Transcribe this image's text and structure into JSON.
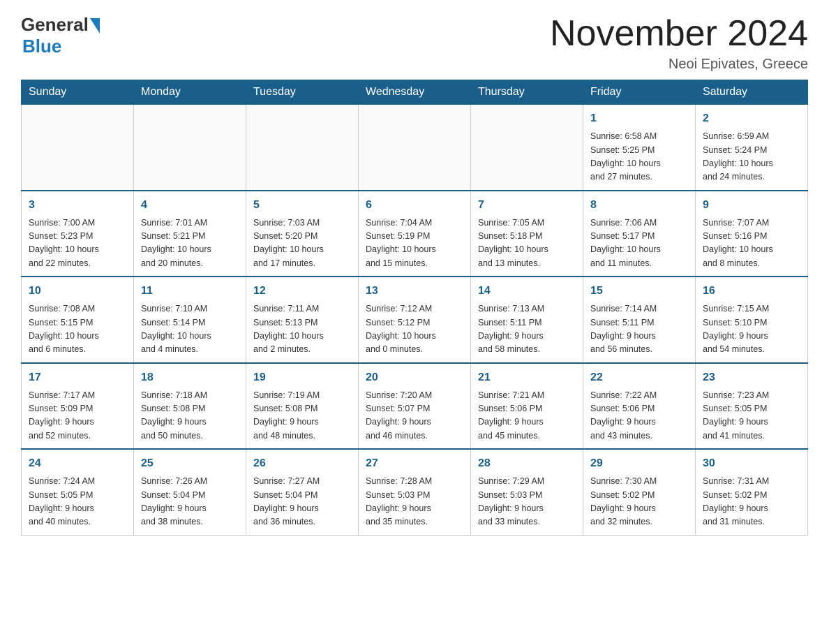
{
  "header": {
    "logo_general": "General",
    "logo_blue": "Blue",
    "title": "November 2024",
    "location": "Neoi Epivates, Greece"
  },
  "weekdays": [
    "Sunday",
    "Monday",
    "Tuesday",
    "Wednesday",
    "Thursday",
    "Friday",
    "Saturday"
  ],
  "weeks": [
    [
      {
        "day": "",
        "info": ""
      },
      {
        "day": "",
        "info": ""
      },
      {
        "day": "",
        "info": ""
      },
      {
        "day": "",
        "info": ""
      },
      {
        "day": "",
        "info": ""
      },
      {
        "day": "1",
        "info": "Sunrise: 6:58 AM\nSunset: 5:25 PM\nDaylight: 10 hours\nand 27 minutes."
      },
      {
        "day": "2",
        "info": "Sunrise: 6:59 AM\nSunset: 5:24 PM\nDaylight: 10 hours\nand 24 minutes."
      }
    ],
    [
      {
        "day": "3",
        "info": "Sunrise: 7:00 AM\nSunset: 5:23 PM\nDaylight: 10 hours\nand 22 minutes."
      },
      {
        "day": "4",
        "info": "Sunrise: 7:01 AM\nSunset: 5:21 PM\nDaylight: 10 hours\nand 20 minutes."
      },
      {
        "day": "5",
        "info": "Sunrise: 7:03 AM\nSunset: 5:20 PM\nDaylight: 10 hours\nand 17 minutes."
      },
      {
        "day": "6",
        "info": "Sunrise: 7:04 AM\nSunset: 5:19 PM\nDaylight: 10 hours\nand 15 minutes."
      },
      {
        "day": "7",
        "info": "Sunrise: 7:05 AM\nSunset: 5:18 PM\nDaylight: 10 hours\nand 13 minutes."
      },
      {
        "day": "8",
        "info": "Sunrise: 7:06 AM\nSunset: 5:17 PM\nDaylight: 10 hours\nand 11 minutes."
      },
      {
        "day": "9",
        "info": "Sunrise: 7:07 AM\nSunset: 5:16 PM\nDaylight: 10 hours\nand 8 minutes."
      }
    ],
    [
      {
        "day": "10",
        "info": "Sunrise: 7:08 AM\nSunset: 5:15 PM\nDaylight: 10 hours\nand 6 minutes."
      },
      {
        "day": "11",
        "info": "Sunrise: 7:10 AM\nSunset: 5:14 PM\nDaylight: 10 hours\nand 4 minutes."
      },
      {
        "day": "12",
        "info": "Sunrise: 7:11 AM\nSunset: 5:13 PM\nDaylight: 10 hours\nand 2 minutes."
      },
      {
        "day": "13",
        "info": "Sunrise: 7:12 AM\nSunset: 5:12 PM\nDaylight: 10 hours\nand 0 minutes."
      },
      {
        "day": "14",
        "info": "Sunrise: 7:13 AM\nSunset: 5:11 PM\nDaylight: 9 hours\nand 58 minutes."
      },
      {
        "day": "15",
        "info": "Sunrise: 7:14 AM\nSunset: 5:11 PM\nDaylight: 9 hours\nand 56 minutes."
      },
      {
        "day": "16",
        "info": "Sunrise: 7:15 AM\nSunset: 5:10 PM\nDaylight: 9 hours\nand 54 minutes."
      }
    ],
    [
      {
        "day": "17",
        "info": "Sunrise: 7:17 AM\nSunset: 5:09 PM\nDaylight: 9 hours\nand 52 minutes."
      },
      {
        "day": "18",
        "info": "Sunrise: 7:18 AM\nSunset: 5:08 PM\nDaylight: 9 hours\nand 50 minutes."
      },
      {
        "day": "19",
        "info": "Sunrise: 7:19 AM\nSunset: 5:08 PM\nDaylight: 9 hours\nand 48 minutes."
      },
      {
        "day": "20",
        "info": "Sunrise: 7:20 AM\nSunset: 5:07 PM\nDaylight: 9 hours\nand 46 minutes."
      },
      {
        "day": "21",
        "info": "Sunrise: 7:21 AM\nSunset: 5:06 PM\nDaylight: 9 hours\nand 45 minutes."
      },
      {
        "day": "22",
        "info": "Sunrise: 7:22 AM\nSunset: 5:06 PM\nDaylight: 9 hours\nand 43 minutes."
      },
      {
        "day": "23",
        "info": "Sunrise: 7:23 AM\nSunset: 5:05 PM\nDaylight: 9 hours\nand 41 minutes."
      }
    ],
    [
      {
        "day": "24",
        "info": "Sunrise: 7:24 AM\nSunset: 5:05 PM\nDaylight: 9 hours\nand 40 minutes."
      },
      {
        "day": "25",
        "info": "Sunrise: 7:26 AM\nSunset: 5:04 PM\nDaylight: 9 hours\nand 38 minutes."
      },
      {
        "day": "26",
        "info": "Sunrise: 7:27 AM\nSunset: 5:04 PM\nDaylight: 9 hours\nand 36 minutes."
      },
      {
        "day": "27",
        "info": "Sunrise: 7:28 AM\nSunset: 5:03 PM\nDaylight: 9 hours\nand 35 minutes."
      },
      {
        "day": "28",
        "info": "Sunrise: 7:29 AM\nSunset: 5:03 PM\nDaylight: 9 hours\nand 33 minutes."
      },
      {
        "day": "29",
        "info": "Sunrise: 7:30 AM\nSunset: 5:02 PM\nDaylight: 9 hours\nand 32 minutes."
      },
      {
        "day": "30",
        "info": "Sunrise: 7:31 AM\nSunset: 5:02 PM\nDaylight: 9 hours\nand 31 minutes."
      }
    ]
  ]
}
